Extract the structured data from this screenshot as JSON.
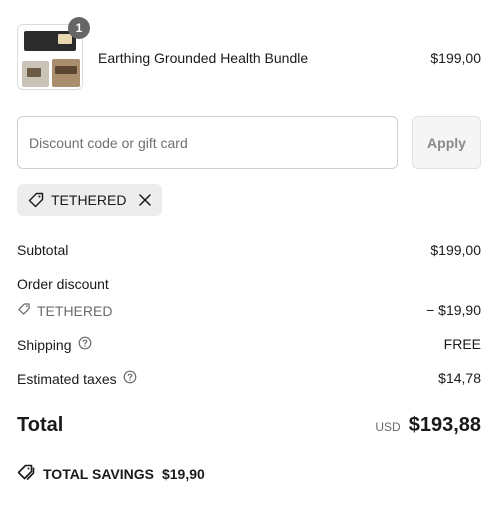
{
  "product": {
    "name": "Earthing Grounded Health Bundle",
    "price": "$199,00",
    "quantity": "1"
  },
  "discount": {
    "placeholder": "Discount code or gift card",
    "value": "",
    "apply_label": "Apply",
    "applied_code": "TETHERED"
  },
  "summary": {
    "subtotal_label": "Subtotal",
    "subtotal_value": "$199,00",
    "order_discount_label": "Order discount",
    "order_discount_code": "TETHERED",
    "order_discount_value": "− $19,90",
    "shipping_label": "Shipping",
    "shipping_value": "FREE",
    "taxes_label": "Estimated taxes",
    "taxes_value": "$14,78"
  },
  "total": {
    "label": "Total",
    "currency": "USD",
    "value": "$193,88"
  },
  "savings": {
    "label": "TOTAL SAVINGS",
    "value": "$19,90"
  },
  "icons": {
    "tag": "tag-icon",
    "close": "close-icon",
    "help": "help-circle-icon",
    "tags": "tags-icon"
  }
}
